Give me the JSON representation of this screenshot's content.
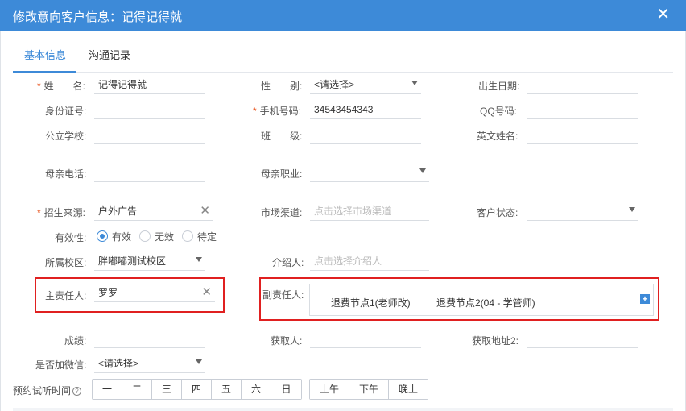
{
  "dialog": {
    "title": "修改意向客户信息：记得记得就",
    "close_glyph": "✕"
  },
  "tabs": [
    {
      "label": "基本信息",
      "active": true
    },
    {
      "label": "沟通记录",
      "active": false
    }
  ],
  "colors": {
    "accent": "#3d8ad8",
    "required": "#e8541e",
    "highlight_box": "#e02020"
  },
  "form": {
    "name": {
      "label": "姓　　名:",
      "required": true,
      "value": "记得记得就"
    },
    "gender": {
      "label": "性　　别:",
      "value": "<请选择>"
    },
    "birthday": {
      "label": "出生日期:",
      "value": ""
    },
    "id_number": {
      "label": "身份证号:",
      "value": ""
    },
    "mobile": {
      "label": "手机号码:",
      "required": true,
      "value": "34543454343"
    },
    "qq": {
      "label": "QQ号码:",
      "value": ""
    },
    "public_school": {
      "label": "公立学校:",
      "value": ""
    },
    "class": {
      "label": "班　　级:",
      "value": ""
    },
    "english_name": {
      "label": "英文姓名:",
      "value": ""
    },
    "mother_phone": {
      "label": "母亲电话:",
      "value": ""
    },
    "mother_job": {
      "label": "母亲职业:",
      "value": ""
    },
    "source": {
      "label": "招生来源:",
      "required": true,
      "value": "户外广告"
    },
    "channel": {
      "label": "市场渠道:",
      "placeholder": "点击选择市场渠道"
    },
    "status": {
      "label": "客户状态:",
      "value": ""
    },
    "validity": {
      "label": "有效性:",
      "options": [
        "有效",
        "无效",
        "待定"
      ],
      "selected": "有效"
    },
    "campus": {
      "label": "所属校区:",
      "value": "胖嘟嘟测试校区"
    },
    "referrer": {
      "label": "介绍人:",
      "placeholder": "点击选择介绍人"
    },
    "main_owner": {
      "label": "主责任人:",
      "value": "罗罗"
    },
    "vice_owner": {
      "label": "副责任人:",
      "items": [
        "退费节点1(老师改)",
        "退费节点2(04 - 学管师)"
      ]
    },
    "score": {
      "label": "成绩:",
      "value": ""
    },
    "acquirer": {
      "label": "获取人:",
      "value": ""
    },
    "address2": {
      "label": "获取地址2:",
      "value": ""
    },
    "wechat": {
      "label": "是否加微信:",
      "value": "<请选择>"
    },
    "trial_time": {
      "label": "预约试听时间",
      "help_glyph": "?",
      "weekdays": [
        "一",
        "二",
        "三",
        "四",
        "五",
        "六",
        "日"
      ],
      "periods": [
        "上午",
        "下午",
        "晚上"
      ]
    }
  }
}
